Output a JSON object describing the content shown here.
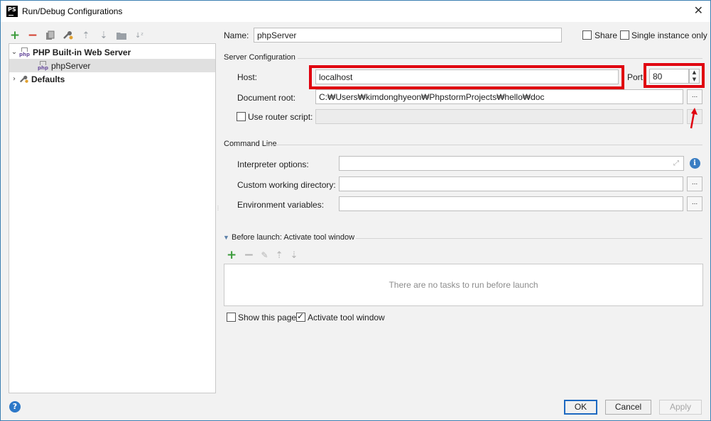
{
  "window": {
    "title": "Run/Debug Configurations",
    "logo_text": "PS"
  },
  "left_toolbar": {
    "icons": [
      "add-icon",
      "remove-icon",
      "copy-icon",
      "edit-defaults-icon",
      "move-up-icon",
      "move-down-icon",
      "folder-icon",
      "sort-icon"
    ]
  },
  "tree": {
    "items": [
      {
        "label": "PHP Built-in Web Server",
        "expanded": true
      },
      {
        "label": "phpServer",
        "selected": true
      },
      {
        "label": "Defaults",
        "expanded": false
      }
    ]
  },
  "form": {
    "name_label": "Name:",
    "name_value": "phpServer",
    "share_label": "Share",
    "single_instance_label": "Single instance only",
    "server_config_section": "Server Configuration",
    "host_label": "Host:",
    "host_value": "localhost",
    "port_label": "Port:",
    "port_value": "80",
    "doc_root_label": "Document root:",
    "doc_root_value": "C:₩Users₩kimdonghyeon₩PhpstormProjects₩hello₩doc",
    "browse_label": "...",
    "router_script_label": "Use router script:",
    "command_line_section": "Command Line",
    "interpreter_options_label": "Interpreter options:",
    "custom_wd_label": "Custom working directory:",
    "env_vars_label": "Environment variables:",
    "before_launch_section": "Before launch: Activate tool window",
    "no_tasks_text": "There are no tasks to run before launch",
    "show_page_label": "Show this page",
    "activate_tool_label": "Activate tool window"
  },
  "buttons": {
    "ok": "OK",
    "cancel": "Cancel",
    "apply": "Apply"
  },
  "annotations_color": "#e0000f"
}
